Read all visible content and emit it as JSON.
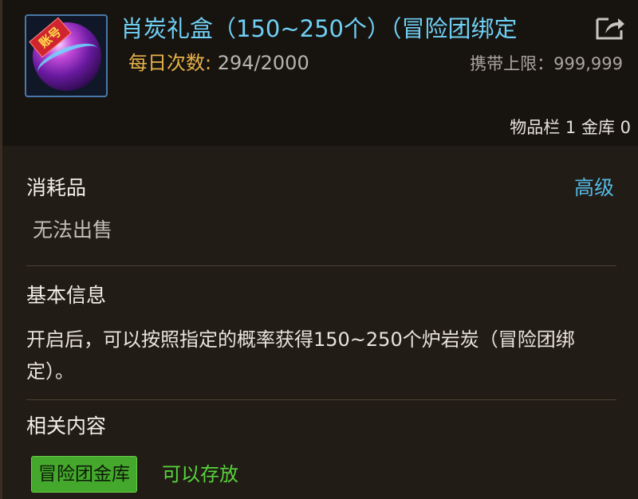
{
  "item": {
    "title": "肖炭礼盒（150~250个）（冒险团绑定",
    "badge": "账号",
    "daily_label": "每日次数:",
    "daily_value": "294/2000",
    "carry_limit": "携带上限：999,999",
    "storage": "物品栏 1 金库 0"
  },
  "info": {
    "category": "消耗品",
    "grade": "高级",
    "sell_status": "无法出售",
    "basic_title": "基本信息",
    "description": "开启后，可以按照指定的概率获得150~250个炉岩炭（冒险团绑定）。",
    "related_title": "相关内容",
    "tag_label": "冒险团金库",
    "tag_status": "可以存放"
  },
  "icons": {
    "item_icon": "purple-orb-item-icon",
    "export": "export-arrow-icon"
  },
  "colors": {
    "title": "#6fd0f4",
    "daily_label": "#e6b24a",
    "grade": "#54b8e4",
    "tag_bg": "#44a82c",
    "storable": "#56d43a"
  }
}
